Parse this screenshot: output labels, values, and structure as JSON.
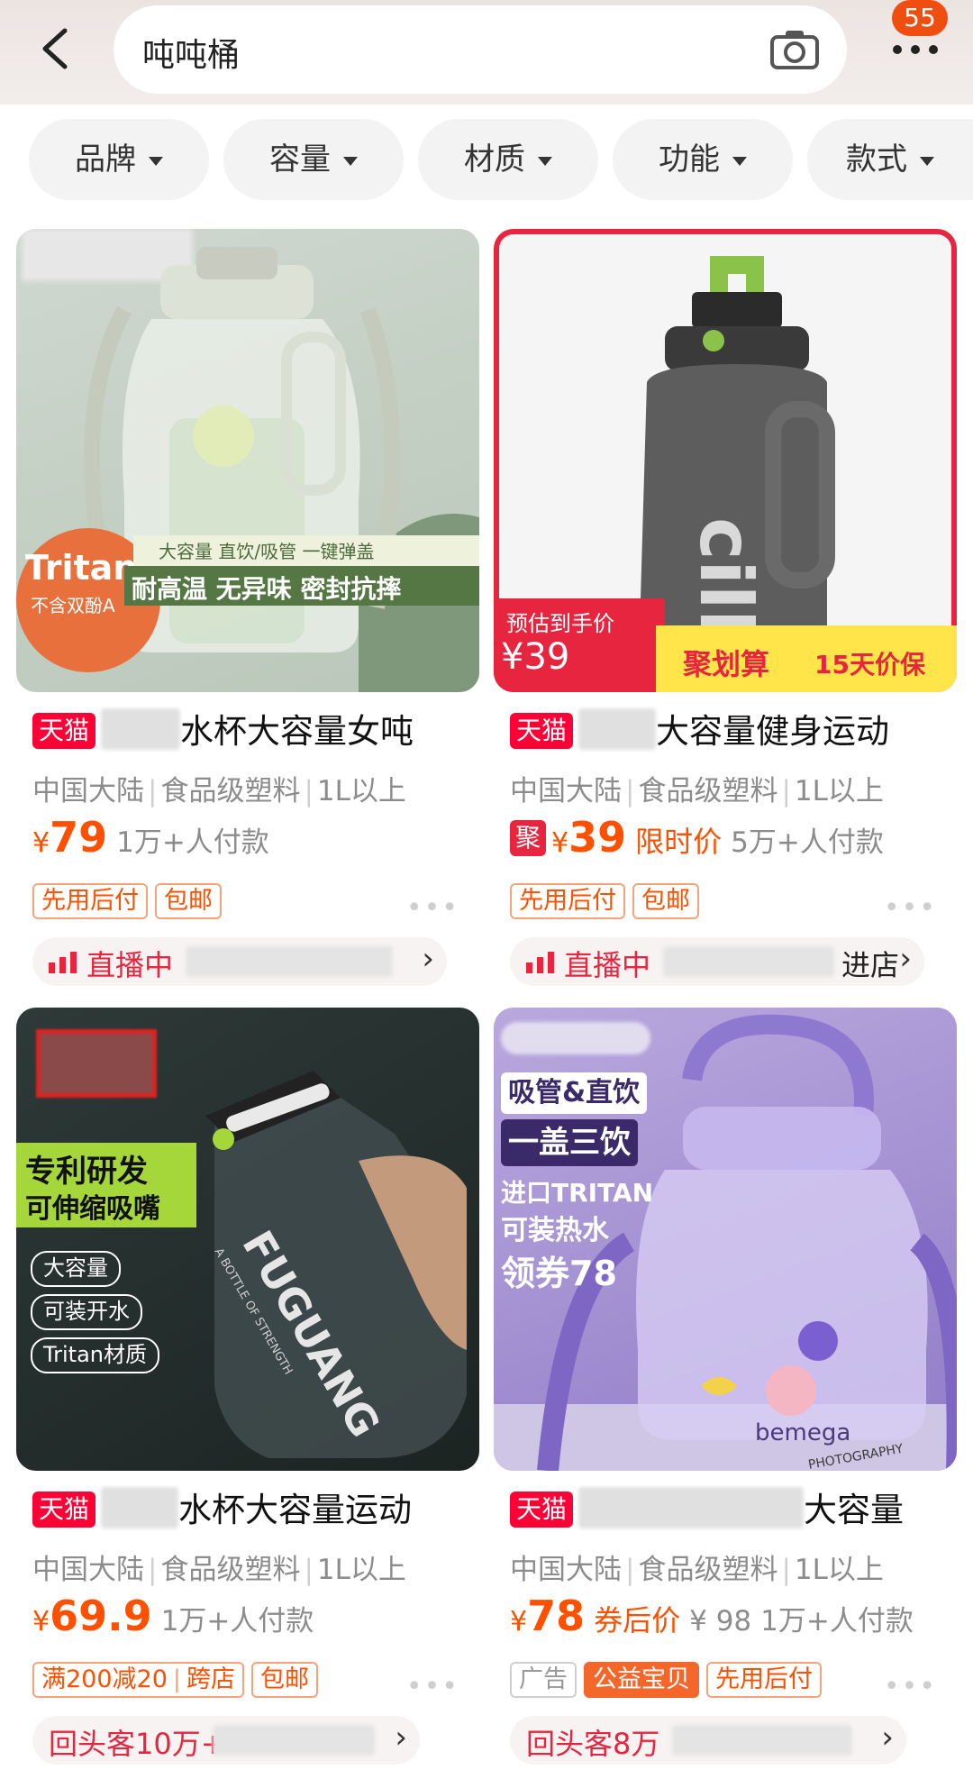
{
  "search": {
    "query": "吨吨桶"
  },
  "header": {
    "badge_count": "55",
    "back_icon": "chevron-left-icon",
    "camera_icon": "camera-icon",
    "more_icon": "more-dots-icon"
  },
  "filters": [
    "品牌",
    "容量",
    "材质",
    "功能",
    "款式"
  ],
  "products": [
    {
      "image_overlay": {
        "material_badge": "Tritan",
        "material_sub": "不含双酚A",
        "line1": "大容量 直饮/吸管 一键弹盖",
        "line2": "耐高温 无异味 密封抗摔"
      },
      "store_tag": "天猫",
      "title_suffix": "水杯大容量女吨",
      "attrs": [
        "中国大陆",
        "食品级塑料",
        "1L以上"
      ],
      "yen": "¥",
      "price": "79",
      "sold": "1万+人付款",
      "tags": [
        "先用后付",
        "包邮"
      ],
      "live_label": "直播中"
    },
    {
      "image_overlay": {
        "estimate_label": "预估到手价",
        "estimate_price": "¥39",
        "promo_label": "聚划算",
        "promo_sub": "15天价保",
        "brand_text": "cille"
      },
      "store_tag": "天猫",
      "title_suffix": "大容量健身运动",
      "attrs": [
        "中国大陆",
        "食品级塑料",
        "1L以上"
      ],
      "ju_tag": "聚",
      "yen": "¥",
      "price": "39",
      "price_note": "限时价",
      "sold": "5万+人付款",
      "tags": [
        "先用后付",
        "包邮"
      ],
      "live_label": "直播中",
      "live_suffix": "进店"
    },
    {
      "image_overlay": {
        "headline1": "专利研发",
        "headline2": "可伸缩吸嘴",
        "chips": [
          "大容量",
          "可装开水",
          "Tritan材质"
        ],
        "brand_text": "FUGUANG",
        "brand_sub": "A BOTTLE OF STRENGTH"
      },
      "store_tag": "天猫",
      "title_suffix": "水杯大容量运动",
      "attrs": [
        "中国大陆",
        "食品级塑料",
        "1L以上"
      ],
      "yen": "¥",
      "price": "69.9",
      "sold": "1万+人付款",
      "tags": [
        "满200减20",
        "跨店",
        "包邮"
      ],
      "repeat_label": "回头客10万+"
    },
    {
      "image_overlay": {
        "line1": "吸管&直饮",
        "line2": "一盖三饮",
        "line3": "进口TRITAN",
        "line4": "可装热水",
        "line5": "领券78",
        "brand_text": "bemega",
        "book_text": "PHOTOGRAPHY"
      },
      "store_tag": "天猫",
      "title_suffix": "大容量",
      "attrs": [
        "中国大陆",
        "食品级塑料",
        "1L以上"
      ],
      "yen": "¥",
      "price": "78",
      "price_note": "券后价",
      "orig_price": "¥ 98",
      "sold": "1万+人付款",
      "tags": [
        "广告",
        "公益宝贝",
        "先用后付"
      ],
      "repeat_label": "回头客8万"
    }
  ]
}
